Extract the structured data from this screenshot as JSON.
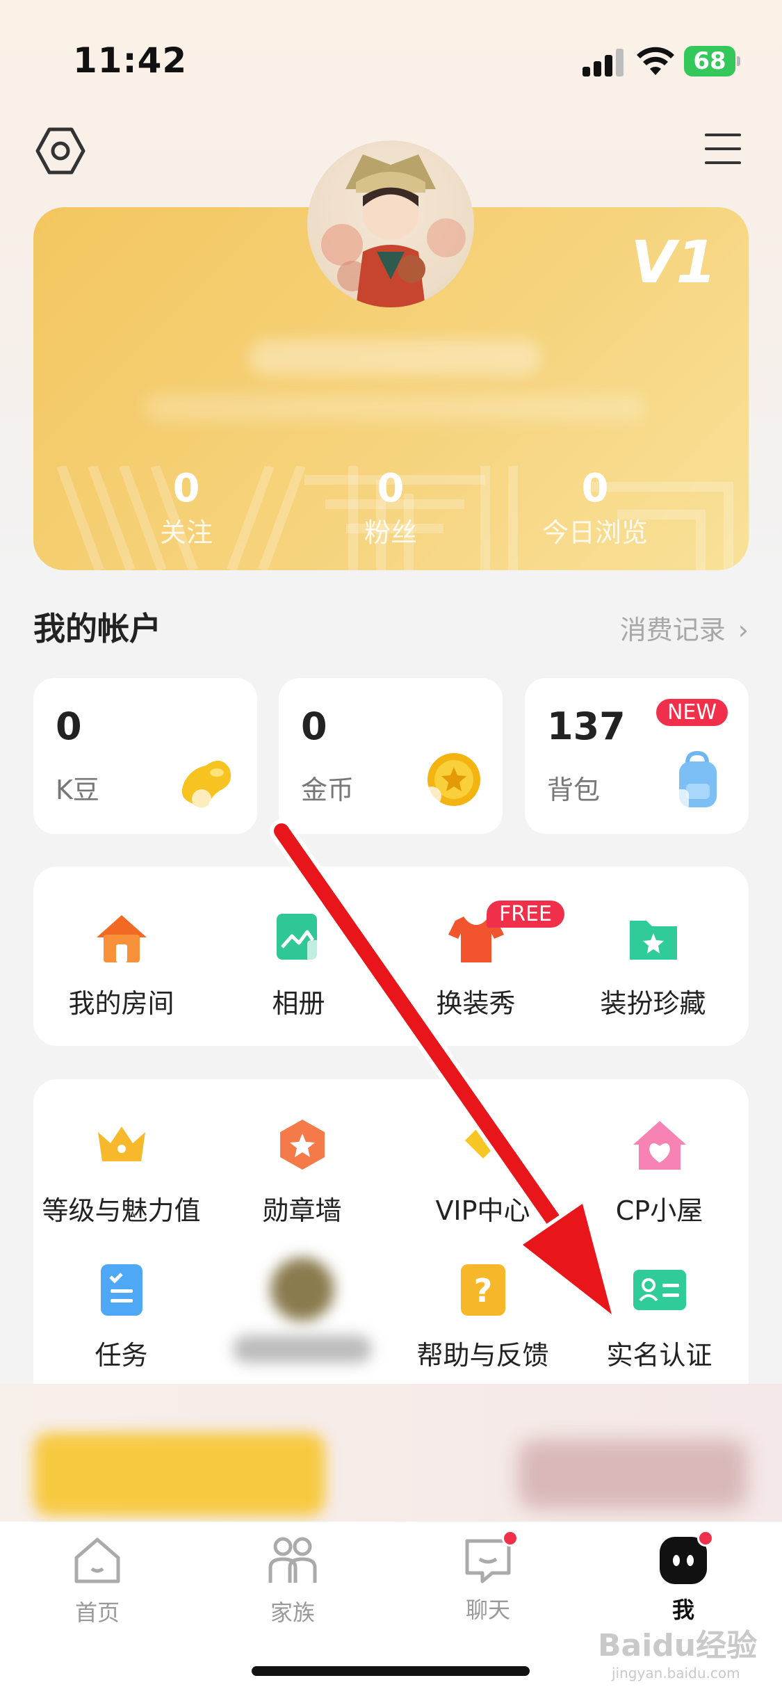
{
  "status_bar": {
    "time": "11:42",
    "battery": "68"
  },
  "profile": {
    "level": "V1",
    "stats": [
      {
        "value": "0",
        "label": "关注"
      },
      {
        "value": "0",
        "label": "粉丝"
      },
      {
        "value": "0",
        "label": "今日浏览"
      }
    ]
  },
  "account": {
    "title": "我的帐户",
    "link": "消费记录",
    "cards": [
      {
        "value": "0",
        "label": "K豆",
        "icon": "bean-icon"
      },
      {
        "value": "0",
        "label": "金币",
        "icon": "coin-icon"
      },
      {
        "value": "137",
        "label": "背包",
        "icon": "backpack-icon",
        "badge": "NEW"
      }
    ]
  },
  "quick": [
    {
      "label": "我的房间",
      "icon": "house-icon"
    },
    {
      "label": "相册",
      "icon": "album-icon"
    },
    {
      "label": "换装秀",
      "icon": "tshirt-icon",
      "badge": "FREE"
    },
    {
      "label": "装扮珍藏",
      "icon": "folder-star-icon"
    }
  ],
  "services": [
    {
      "label": "等级与魅力值",
      "icon": "crown-icon"
    },
    {
      "label": "勋章墙",
      "icon": "medal-icon"
    },
    {
      "label": "VIP中心",
      "icon": "vip-icon"
    },
    {
      "label": "CP小屋",
      "icon": "heart-house-icon"
    },
    {
      "label": "任务",
      "icon": "task-icon"
    },
    {
      "label": "",
      "icon": "blurred-icon"
    },
    {
      "label": "帮助与反馈",
      "icon": "help-icon"
    },
    {
      "label": "实名认证",
      "icon": "id-card-icon"
    }
  ],
  "tabs": [
    {
      "label": "首页",
      "icon": "home-icon"
    },
    {
      "label": "家族",
      "icon": "family-icon"
    },
    {
      "label": "聊天",
      "icon": "chat-icon"
    },
    {
      "label": "我",
      "icon": "me-icon"
    }
  ],
  "watermark": {
    "brand": "Baidu经验",
    "url": "jingyan.baidu.com"
  },
  "colors": {
    "card_gold": "#f3c65f",
    "badge_red": "#f0304b",
    "arrow_red": "#e8151b"
  }
}
